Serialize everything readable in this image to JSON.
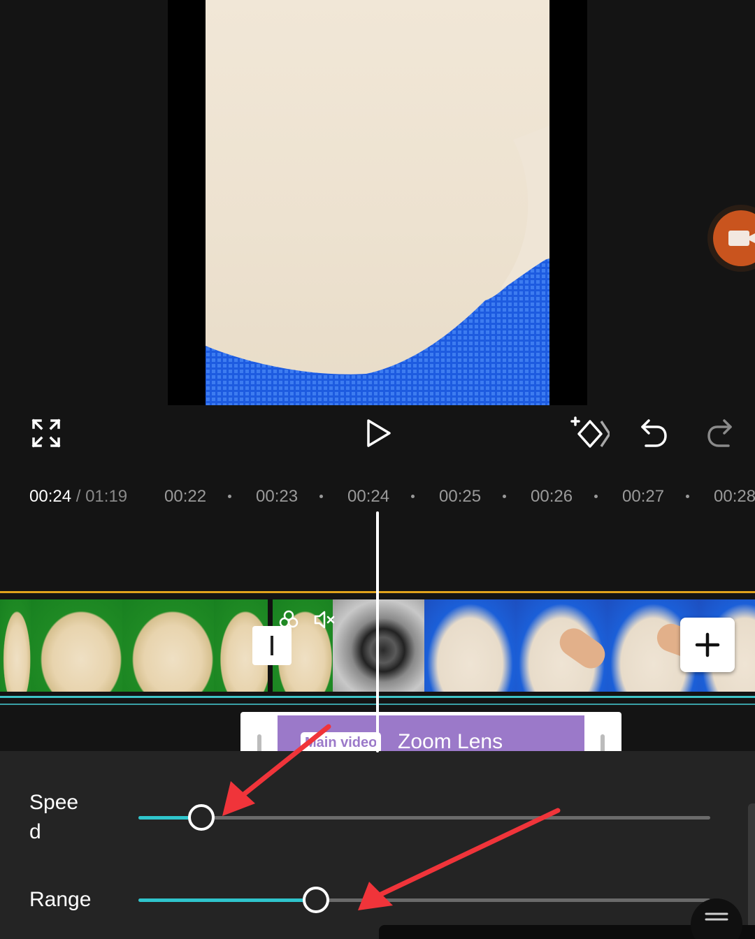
{
  "timeline": {
    "current_time": "00:24",
    "separator": "/",
    "total_time": "01:19",
    "ticks": [
      "00:22",
      "00:23",
      "00:24",
      "00:25",
      "00:26",
      "00:27",
      "00:28"
    ]
  },
  "effect_track": {
    "badge": "Main video",
    "name": "Zoom Lens"
  },
  "adjust_panel": {
    "speed": {
      "label": "Spee\nd",
      "value": 0.11
    },
    "range": {
      "label": "Range",
      "value": 0.31
    }
  },
  "icons": {
    "fullscreen": "fullscreen-icon",
    "play": "play-icon",
    "keyframe": "keyframe-add-icon",
    "undo": "undo-icon",
    "redo": "redo-icon",
    "record": "video-camera-icon",
    "effect": "effect-icon",
    "mute": "mute-icon",
    "add": "plus-icon",
    "menu": "menu-icon"
  },
  "colors": {
    "accent_teal": "#2fc5cc",
    "effect_purple": "#9b79c9",
    "track_orange": "#e0a21c",
    "record_orange": "#c9541e",
    "annotation_red": "#f0343a"
  }
}
